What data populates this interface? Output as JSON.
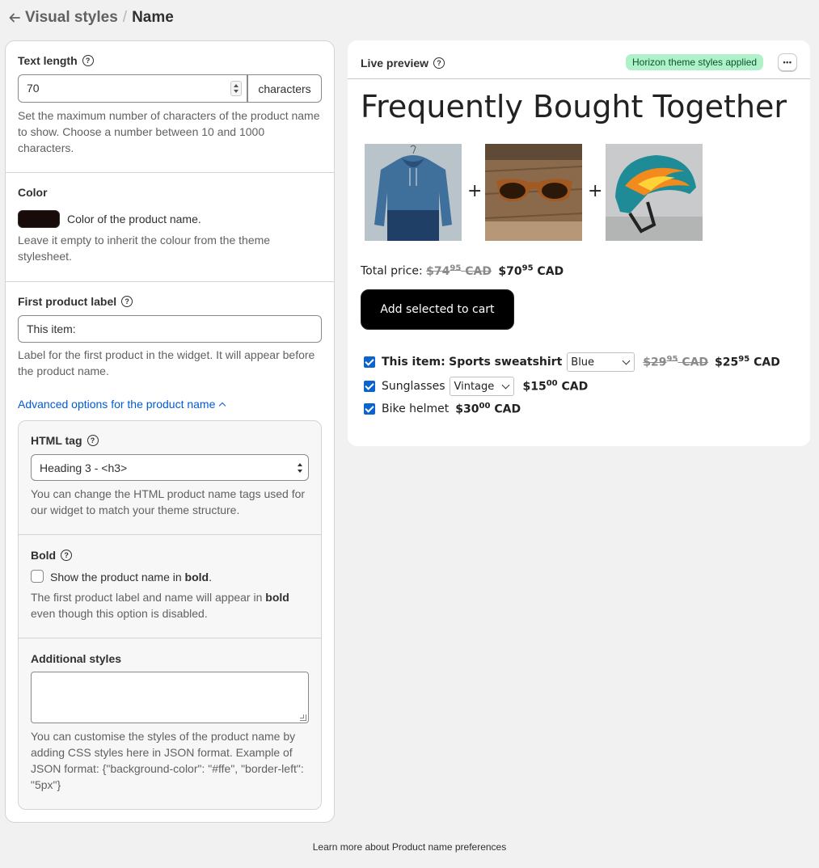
{
  "breadcrumb": {
    "parent": "Visual styles",
    "separator": "/",
    "current": "Name"
  },
  "text_length": {
    "label": "Text length",
    "value": "70",
    "unit": "characters",
    "hint": "Set the maximum number of characters of the product name to show. Choose a number between 10 and 1000 characters."
  },
  "color": {
    "label": "Color",
    "swatch_hex": "#180c0a",
    "swatch_label": "Color of the product name.",
    "hint": "Leave it empty to inherit the colour from the theme stylesheet."
  },
  "first_label": {
    "label": "First product label",
    "value": "This item:",
    "hint": "Label for the first product in the widget. It will appear before the product name."
  },
  "advanced_link": "Advanced options for the product name",
  "html_tag": {
    "label": "HTML tag",
    "value": "Heading 3 - <h3>",
    "hint": "You can change the HTML product name tags used for our widget to match your theme structure."
  },
  "bold": {
    "label": "Bold",
    "checkbox_text": "Show the product name in",
    "checkbox_bold": "bold",
    "hint_pre": "The first product label and name will appear in",
    "hint_bold": "bold",
    "hint_post": "even though this option is disabled."
  },
  "additional": {
    "label": "Additional styles",
    "value": "",
    "hint": "You can customise the styles of the product name by adding CSS styles here in JSON format. Example of JSON format: {\"background-color\": \"#ffe\", \"border-left\": \"5px\"}"
  },
  "preview": {
    "title": "Live preview",
    "badge": "Horizon theme styles applied",
    "more": "•••",
    "heading": "Frequently Bought Together",
    "plus": "+",
    "total_label": "Total price:",
    "total_old_int": "$74",
    "total_old_dec": "95",
    "total_old_cur": "CAD",
    "total_new_int": "$70",
    "total_new_dec": "95",
    "total_new_cur": "CAD",
    "cart_button": "Add selected to cart",
    "items": [
      {
        "prefix": "This item:",
        "name": "Sports sweatshirt",
        "variant": "Blue",
        "old_int": "$29",
        "old_dec": "95",
        "old_cur": "CAD",
        "new_int": "$25",
        "new_dec": "95",
        "new_cur": "CAD"
      },
      {
        "name": "Sunglasses",
        "variant": "Vintage",
        "new_int": "$15",
        "new_dec": "00",
        "new_cur": "CAD"
      },
      {
        "name": "Bike helmet",
        "new_int": "$30",
        "new_dec": "00",
        "new_cur": "CAD"
      }
    ]
  },
  "footer": {
    "text": "Learn more about Product name preferences"
  }
}
